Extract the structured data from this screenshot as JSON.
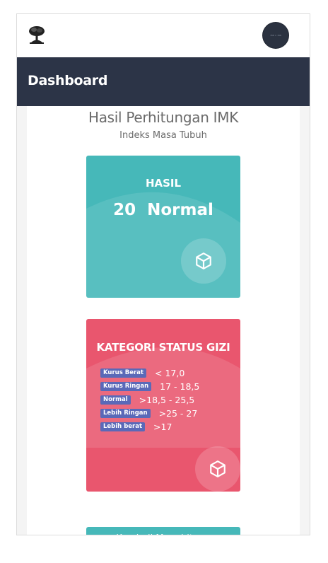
{
  "header": {
    "title": "Dashboard"
  },
  "avatar": {
    "text": "156 × 156"
  },
  "main": {
    "title": "Hasil Perhitungan IMK",
    "subtitle": "Indeks Masa Tubuh"
  },
  "result_card": {
    "label": "HASIL",
    "value": "20",
    "status": "Normal",
    "icon": "cube-icon",
    "color": "#46b8b9"
  },
  "category_card": {
    "title": "KATEGORI STATUS GIZI",
    "icon": "cube-icon",
    "color": "#e9566e",
    "items": [
      {
        "label": "Kurus Berat",
        "range": "< 17,0"
      },
      {
        "label": "Kurus Ringan",
        "range": "17 - 18,5"
      },
      {
        "label": "Normal",
        "range": ">18,5 - 25,5"
      },
      {
        "label": "Lebih Ringan",
        "range": ">25 - 27"
      },
      {
        "label": "Lebih berat",
        "range": ">17"
      }
    ]
  },
  "actions": {
    "back_label": "Kembali Menghitung"
  },
  "colors": {
    "header_bg": "#2c3447",
    "badge_bg": "#5a69b8"
  }
}
